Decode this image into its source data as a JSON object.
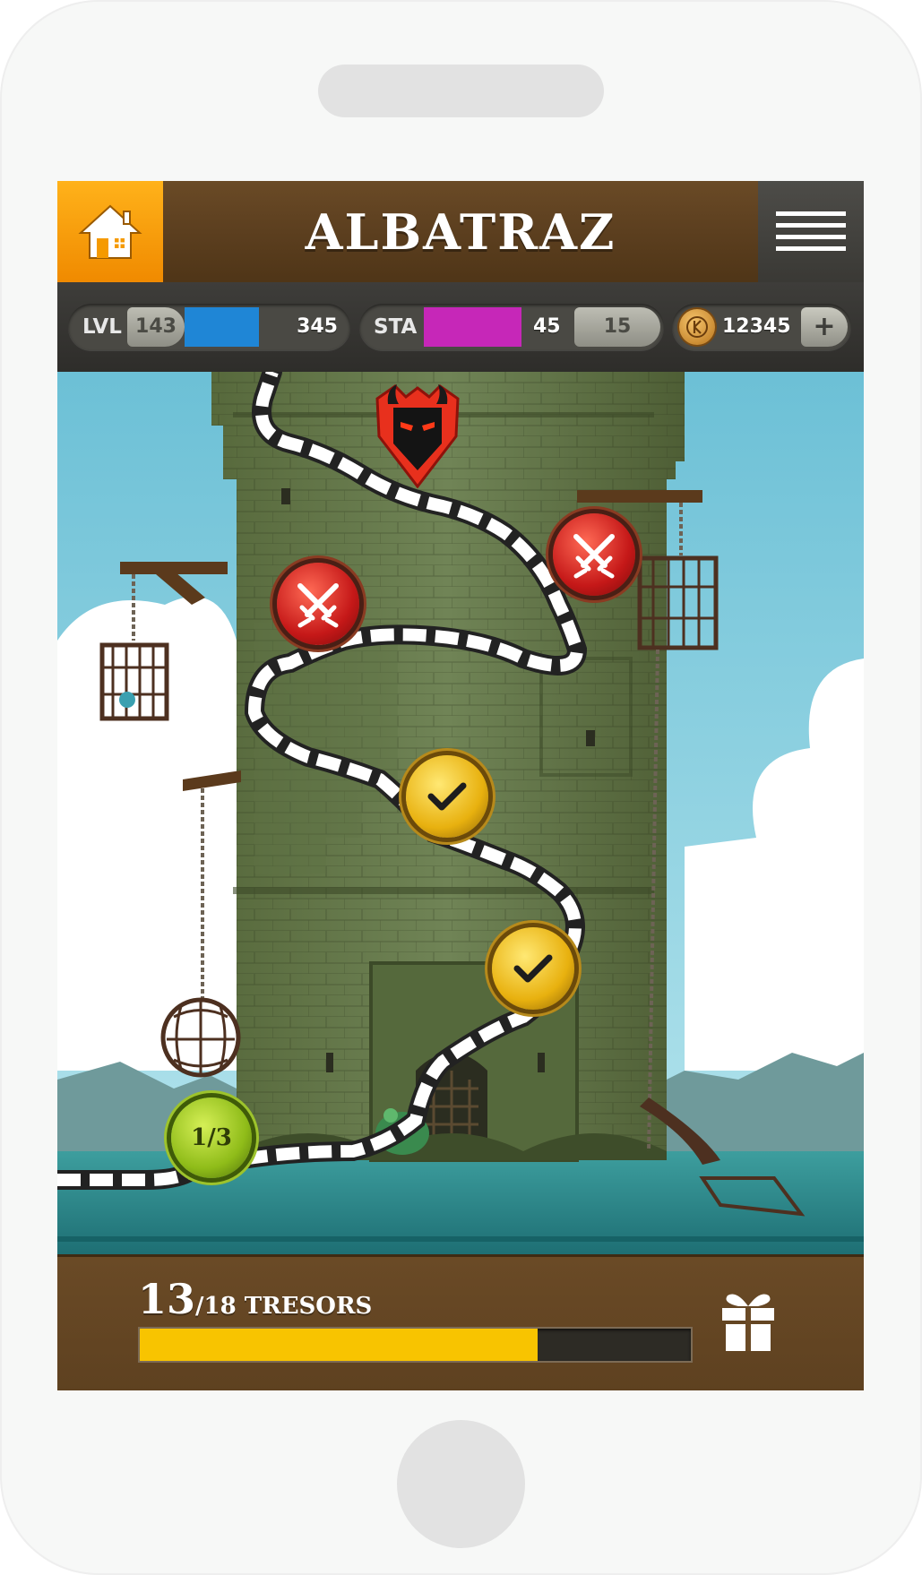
{
  "header": {
    "title": "ALBATRAZ",
    "home_icon": "house-icon",
    "menu_icon": "hamburger-menu-icon"
  },
  "stats": {
    "level_label": "LVL",
    "level_value": "143",
    "xp_value": "345",
    "xp_fraction": 0.55,
    "stamina_label": "STA",
    "stamina_value": "45",
    "stamina_max": "15",
    "stamina_fraction": 0.66,
    "coins_value": "12345",
    "add_label": "+"
  },
  "map": {
    "nodes": [
      {
        "type": "boss"
      },
      {
        "type": "battle"
      },
      {
        "type": "battle"
      },
      {
        "type": "completed"
      },
      {
        "type": "completed"
      },
      {
        "type": "progress",
        "label": "1/3"
      }
    ]
  },
  "footer": {
    "treasures_count": "13",
    "treasures_total": "/18 TRESORS",
    "progress_fraction": 0.7222,
    "gift_icon": "gift-icon"
  },
  "colors": {
    "header_brown": "#5c3f1f",
    "home_orange": "#f59a00",
    "xp_blue": "#1f86d6",
    "stamina_magenta": "#c627b8",
    "treasure_yellow": "#f8c400"
  }
}
